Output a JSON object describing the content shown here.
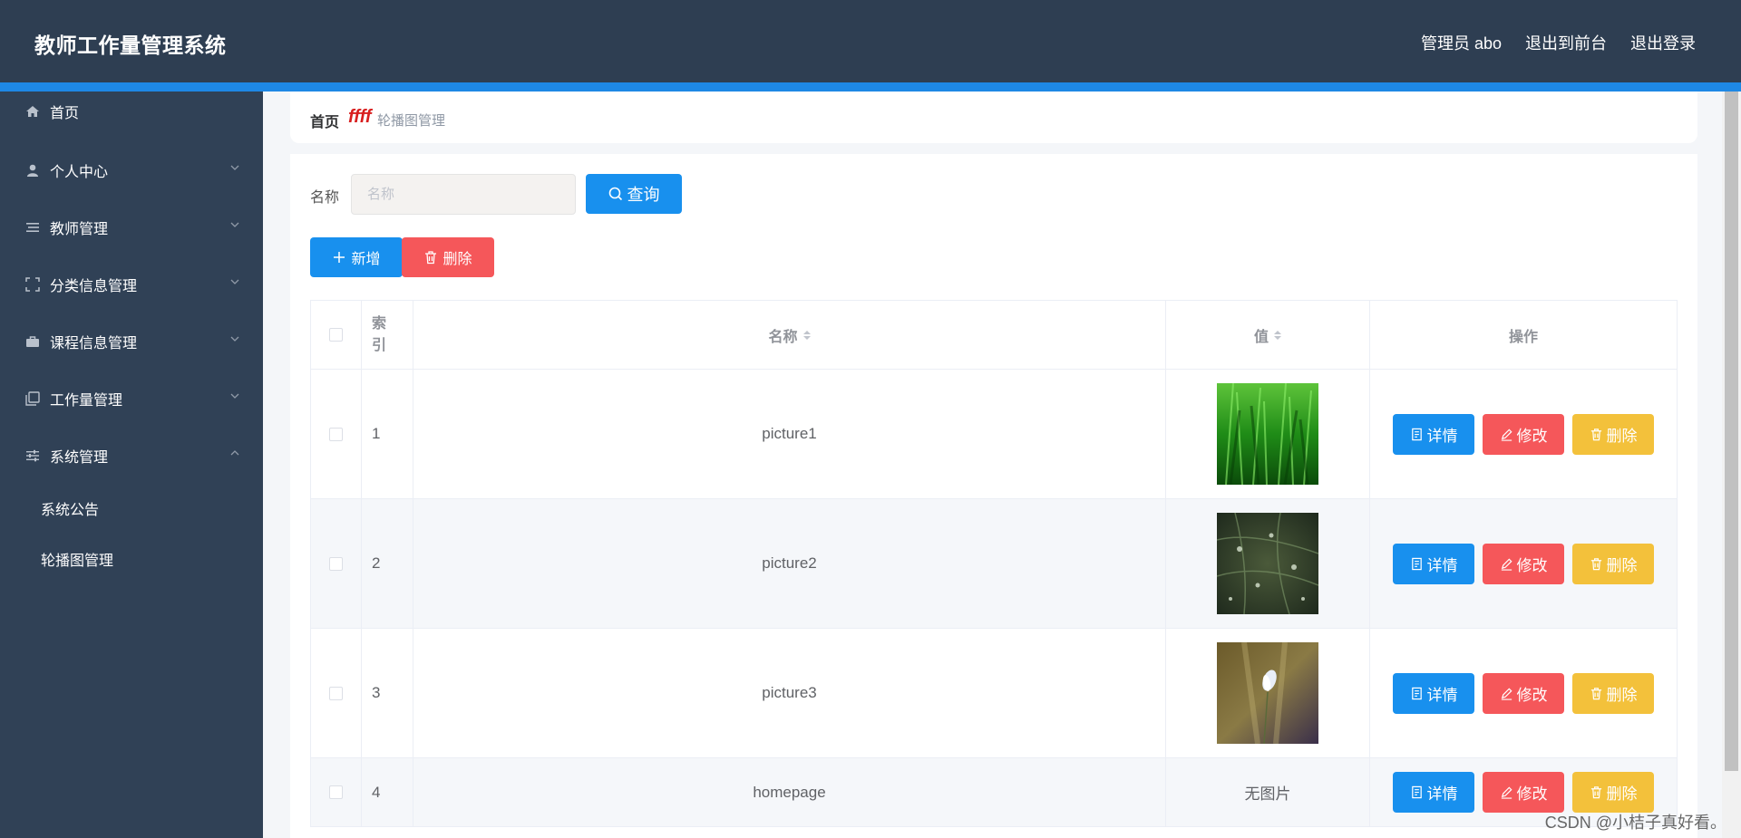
{
  "header": {
    "title": "教师工作量管理系统",
    "user": "管理员 abo",
    "exit_front": "退出到前台",
    "logout": "退出登录"
  },
  "sidebar": {
    "items": [
      {
        "label": "首页",
        "icon": "home-icon"
      },
      {
        "label": "个人中心",
        "icon": "user-icon"
      },
      {
        "label": "教师管理",
        "icon": "list-icon"
      },
      {
        "label": "分类信息管理",
        "icon": "frame-icon"
      },
      {
        "label": "课程信息管理",
        "icon": "briefcase-icon"
      },
      {
        "label": "工作量管理",
        "icon": "copy-icon"
      },
      {
        "label": "系统管理",
        "icon": "sliders-icon"
      }
    ],
    "subitems": [
      {
        "label": "系统公告"
      },
      {
        "label": "轮播图管理"
      }
    ]
  },
  "breadcrumb": {
    "home": "首页",
    "separator": "ffff",
    "current": "轮播图管理"
  },
  "search": {
    "label": "名称",
    "placeholder": "名称",
    "query_button": "查询"
  },
  "toolbar": {
    "add_button": "新增",
    "delete_button": "删除"
  },
  "table": {
    "columns": {
      "index": "索引",
      "name": "名称",
      "value": "值",
      "actions": "操作"
    },
    "rows": [
      {
        "index": "1",
        "name": "picture1",
        "value": "image",
        "thumb": "grass"
      },
      {
        "index": "2",
        "name": "picture2",
        "value": "image",
        "thumb": "dark-green"
      },
      {
        "index": "3",
        "name": "picture3",
        "value": "image",
        "thumb": "flower"
      },
      {
        "index": "4",
        "name": "homepage",
        "value": "无图片",
        "thumb": "none"
      }
    ],
    "actions": {
      "detail": "详情",
      "edit": "修改",
      "remove": "删除"
    }
  },
  "watermark": "CSDN @小桔子真好看。",
  "colors": {
    "header_bg": "#2e3e52",
    "sidebar_bg": "#304156",
    "primary": "#1890ee",
    "danger": "#f5575a",
    "warning": "#f3c13b"
  }
}
